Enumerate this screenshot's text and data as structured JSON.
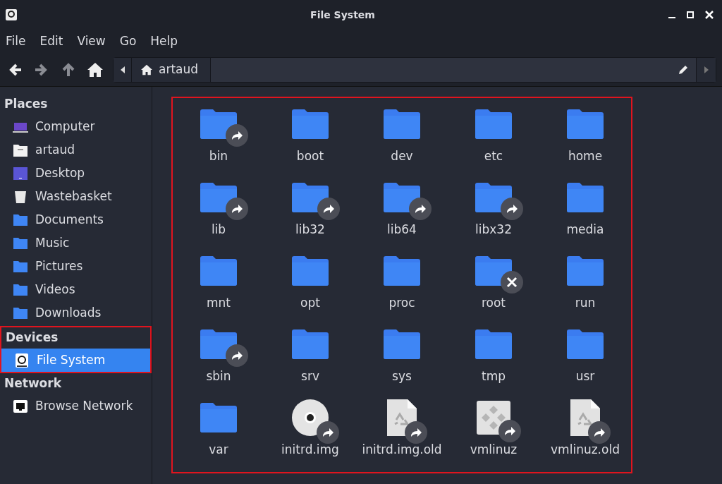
{
  "window": {
    "title": "File System"
  },
  "menu": [
    "File",
    "Edit",
    "View",
    "Go",
    "Help"
  ],
  "toolbar": {
    "back_disabled": false,
    "forward_disabled": true,
    "up_disabled": true
  },
  "path": {
    "segments": [
      {
        "label": "artaud",
        "kind": "home"
      }
    ]
  },
  "sidebar": [
    {
      "heading": "Places",
      "annotated": false,
      "items": [
        {
          "label": "Computer",
          "kind": "computer",
          "selected": false
        },
        {
          "label": "artaud",
          "kind": "home",
          "selected": false
        },
        {
          "label": "Desktop",
          "kind": "desktop",
          "selected": false
        },
        {
          "label": "Wastebasket",
          "kind": "trash",
          "selected": false
        },
        {
          "label": "Documents",
          "kind": "folder",
          "selected": false
        },
        {
          "label": "Music",
          "kind": "folder",
          "selected": false
        },
        {
          "label": "Pictures",
          "kind": "folder",
          "selected": false
        },
        {
          "label": "Videos",
          "kind": "folder",
          "selected": false
        },
        {
          "label": "Downloads",
          "kind": "folder",
          "selected": false
        }
      ]
    },
    {
      "heading": "Devices",
      "annotated": true,
      "items": [
        {
          "label": "File System",
          "kind": "drive",
          "selected": true
        }
      ]
    },
    {
      "heading": "Network",
      "annotated": false,
      "items": [
        {
          "label": "Browse Network",
          "kind": "network",
          "selected": false
        }
      ]
    }
  ],
  "files": {
    "annotated": true,
    "items": [
      {
        "name": "bin",
        "kind": "folder",
        "symlink": true,
        "locked": false
      },
      {
        "name": "boot",
        "kind": "folder",
        "symlink": false,
        "locked": false
      },
      {
        "name": "dev",
        "kind": "folder",
        "symlink": false,
        "locked": false
      },
      {
        "name": "etc",
        "kind": "folder",
        "symlink": false,
        "locked": false
      },
      {
        "name": "home",
        "kind": "folder",
        "symlink": false,
        "locked": false
      },
      {
        "name": "lib",
        "kind": "folder",
        "symlink": true,
        "locked": false
      },
      {
        "name": "lib32",
        "kind": "folder",
        "symlink": true,
        "locked": false
      },
      {
        "name": "lib64",
        "kind": "folder",
        "symlink": true,
        "locked": false
      },
      {
        "name": "libx32",
        "kind": "folder",
        "symlink": true,
        "locked": false
      },
      {
        "name": "media",
        "kind": "folder",
        "symlink": false,
        "locked": false
      },
      {
        "name": "mnt",
        "kind": "folder",
        "symlink": false,
        "locked": false
      },
      {
        "name": "opt",
        "kind": "folder",
        "symlink": false,
        "locked": false
      },
      {
        "name": "proc",
        "kind": "folder",
        "symlink": false,
        "locked": false
      },
      {
        "name": "root",
        "kind": "folder",
        "symlink": false,
        "locked": true
      },
      {
        "name": "run",
        "kind": "folder",
        "symlink": false,
        "locked": false
      },
      {
        "name": "sbin",
        "kind": "folder",
        "symlink": true,
        "locked": false
      },
      {
        "name": "srv",
        "kind": "folder",
        "symlink": false,
        "locked": false
      },
      {
        "name": "sys",
        "kind": "folder",
        "symlink": false,
        "locked": false
      },
      {
        "name": "tmp",
        "kind": "folder",
        "symlink": false,
        "locked": false
      },
      {
        "name": "usr",
        "kind": "folder",
        "symlink": false,
        "locked": false
      },
      {
        "name": "var",
        "kind": "folder",
        "symlink": false,
        "locked": false
      },
      {
        "name": "initrd.img",
        "kind": "disc",
        "symlink": true,
        "locked": false
      },
      {
        "name": "initrd.img.old",
        "kind": "document",
        "symlink": true,
        "locked": false
      },
      {
        "name": "vmlinuz",
        "kind": "executable",
        "symlink": true,
        "locked": false
      },
      {
        "name": "vmlinuz.old",
        "kind": "document",
        "symlink": true,
        "locked": false
      }
    ]
  }
}
